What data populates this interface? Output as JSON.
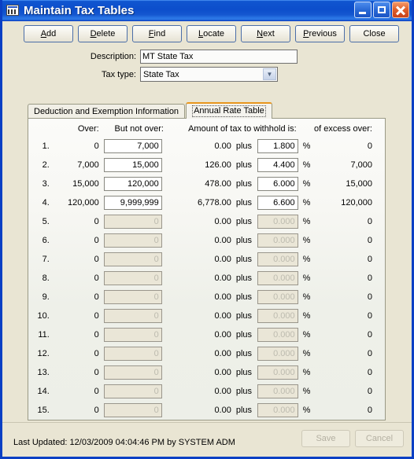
{
  "window": {
    "title": "Maintain Tax Tables",
    "icon": "table-window-icon",
    "controls": {
      "minimize": "minimize-icon",
      "maximize": "maximize-icon",
      "close": "close-icon"
    }
  },
  "toolbar": {
    "buttons": [
      {
        "label": "Add",
        "accel": "A"
      },
      {
        "label": "Delete",
        "accel": "D"
      },
      {
        "label": "Find",
        "accel": "F"
      },
      {
        "label": "Locate",
        "accel": "L"
      },
      {
        "label": "Next",
        "accel": "N"
      },
      {
        "label": "Previous",
        "accel": "P"
      },
      {
        "label": "Close",
        "accel": ""
      }
    ]
  },
  "form": {
    "description_label": "Description:",
    "description_value": "MT State Tax",
    "tax_type_label": "Tax type:",
    "tax_type_value": "State Tax"
  },
  "tabs": [
    {
      "label": "Deduction and Exemption Information",
      "active": false
    },
    {
      "label": "Annual Rate Table",
      "active": true
    }
  ],
  "table": {
    "headers": {
      "num": "",
      "over": "Over:",
      "but_not_over": "But not over:",
      "amount": "Amount of tax to withhold is:",
      "plus": "",
      "rate": "",
      "pct": "",
      "excess": "of excess over:"
    },
    "plus_label": "plus",
    "percent_label": "%",
    "rows": [
      {
        "num": "1.",
        "over": "0",
        "but_not_over": "7,000",
        "amount": "0.00",
        "rate": "1.800",
        "excess": "0",
        "enabled": true
      },
      {
        "num": "2.",
        "over": "7,000",
        "but_not_over": "15,000",
        "amount": "126.00",
        "rate": "4.400",
        "excess": "7,000",
        "enabled": true
      },
      {
        "num": "3.",
        "over": "15,000",
        "but_not_over": "120,000",
        "amount": "478.00",
        "rate": "6.000",
        "excess": "15,000",
        "enabled": true
      },
      {
        "num": "4.",
        "over": "120,000",
        "but_not_over": "9,999,999",
        "amount": "6,778.00",
        "rate": "6.600",
        "excess": "120,000",
        "enabled": true
      },
      {
        "num": "5.",
        "over": "0",
        "but_not_over": "0",
        "amount": "0.00",
        "rate": "0.000",
        "excess": "0",
        "enabled": false
      },
      {
        "num": "6.",
        "over": "0",
        "but_not_over": "0",
        "amount": "0.00",
        "rate": "0.000",
        "excess": "0",
        "enabled": false
      },
      {
        "num": "7.",
        "over": "0",
        "but_not_over": "0",
        "amount": "0.00",
        "rate": "0.000",
        "excess": "0",
        "enabled": false
      },
      {
        "num": "8.",
        "over": "0",
        "but_not_over": "0",
        "amount": "0.00",
        "rate": "0.000",
        "excess": "0",
        "enabled": false
      },
      {
        "num": "9.",
        "over": "0",
        "but_not_over": "0",
        "amount": "0.00",
        "rate": "0.000",
        "excess": "0",
        "enabled": false
      },
      {
        "num": "10.",
        "over": "0",
        "but_not_over": "0",
        "amount": "0.00",
        "rate": "0.000",
        "excess": "0",
        "enabled": false
      },
      {
        "num": "11.",
        "over": "0",
        "but_not_over": "0",
        "amount": "0.00",
        "rate": "0.000",
        "excess": "0",
        "enabled": false
      },
      {
        "num": "12.",
        "over": "0",
        "but_not_over": "0",
        "amount": "0.00",
        "rate": "0.000",
        "excess": "0",
        "enabled": false
      },
      {
        "num": "13.",
        "over": "0",
        "but_not_over": "0",
        "amount": "0.00",
        "rate": "0.000",
        "excess": "0",
        "enabled": false
      },
      {
        "num": "14.",
        "over": "0",
        "but_not_over": "0",
        "amount": "0.00",
        "rate": "0.000",
        "excess": "0",
        "enabled": false
      },
      {
        "num": "15.",
        "over": "0",
        "but_not_over": "0",
        "amount": "0.00",
        "rate": "0.000",
        "excess": "0",
        "enabled": false
      }
    ]
  },
  "status": {
    "last_updated": "Last Updated: 12/03/2009 04:04:46 PM by SYSTEM ADM",
    "save_label": "Save",
    "cancel_label": "Cancel"
  },
  "colors": {
    "titlebar": "#0c4ecb",
    "window_bg": "#e9e5d3",
    "active_tab_accent": "#e8961e",
    "close_button": "#e0622c"
  }
}
